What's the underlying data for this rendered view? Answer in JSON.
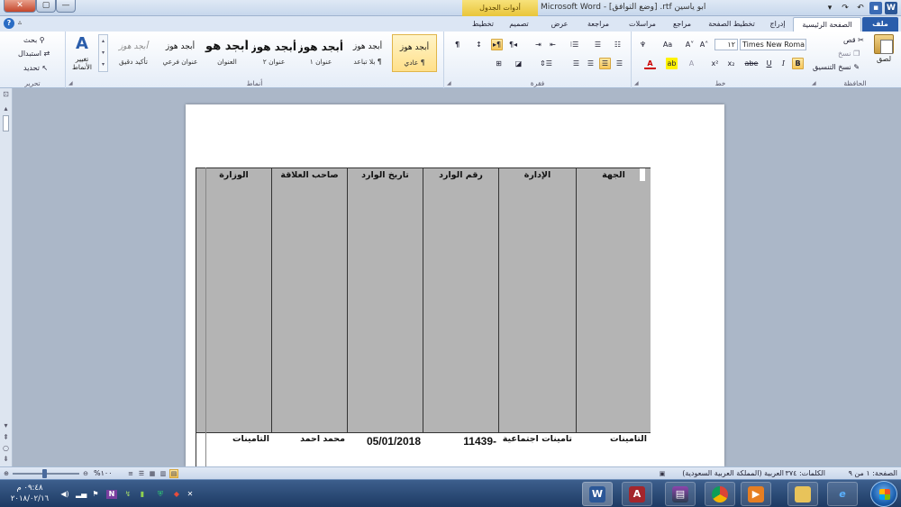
{
  "window": {
    "title": "ابو ياسين rtf. [وضع التوافق] - Microsoft Word",
    "context_tab": "أدوات الجدول",
    "close": "✕",
    "maximize": "▢",
    "minimize": "—"
  },
  "tabs": {
    "file": "ملف",
    "home": "الصفحة الرئيسية",
    "insert": "إدراج",
    "page_layout": "تخطيط الصفحة",
    "references": "مراجع",
    "mailings": "مراسلات",
    "review": "مراجعة",
    "view": "عرض",
    "design": "تصميم",
    "layout": "تخطيط"
  },
  "ribbon": {
    "clipboard": {
      "label": "الحافظة",
      "paste": "لصق",
      "cut": "قص",
      "copy": "نسخ",
      "format_painter": "نسخ التنسيق"
    },
    "font": {
      "label": "خط",
      "font_name": "Times New Roma",
      "font_size": "١٢"
    },
    "paragraph": {
      "label": "فقرة"
    },
    "styles": {
      "label": "أنماط",
      "change_styles": "تغيير الأنماط",
      "items": [
        {
          "sample": "أبجد هوز",
          "name": "¶ عادي"
        },
        {
          "sample": "أبجد هوز",
          "name": "¶ بلا تباعد"
        },
        {
          "sample": "أبجد هوز",
          "name": "عنوان ١"
        },
        {
          "sample": "أبجد هوز",
          "name": "عنوان ٢"
        },
        {
          "sample": "أبجد هو",
          "name": "العنوان"
        },
        {
          "sample": "أبجد هوز",
          "name": "عنوان فرعي"
        },
        {
          "sample": "أبجد هوز",
          "name": "تأكيد دقيق"
        }
      ]
    },
    "editing": {
      "label": "تحرير",
      "find": "بحث",
      "replace": "استبدال",
      "select": "تحديد"
    }
  },
  "document": {
    "headers": [
      "الجهة",
      "الإدارة",
      "رقم الوارد",
      "تاريخ الوارد",
      "صاحب العلاقة",
      "الوزارة"
    ],
    "row": [
      "التامينات",
      "تامينات اجتماعية",
      "11439-",
      "05/01/2018",
      "محمد احمد",
      "التامينات"
    ]
  },
  "statusbar": {
    "page": "الصفحة: ١ من ٩",
    "words": "الكلمات: ٣٧٤",
    "language": "العربية (المملكة العربية السعودية)",
    "zoom": "%١٠٠"
  },
  "taskbar": {
    "time": "٠٩:٤٨ م",
    "date": "٢٠١٨/٠٢/١٦"
  },
  "colors": {
    "file_tab": "#2a5dab",
    "context_tab": "#e9c53a",
    "header_cell": "#b4b4b4",
    "taskbar": "#1d3a63"
  }
}
